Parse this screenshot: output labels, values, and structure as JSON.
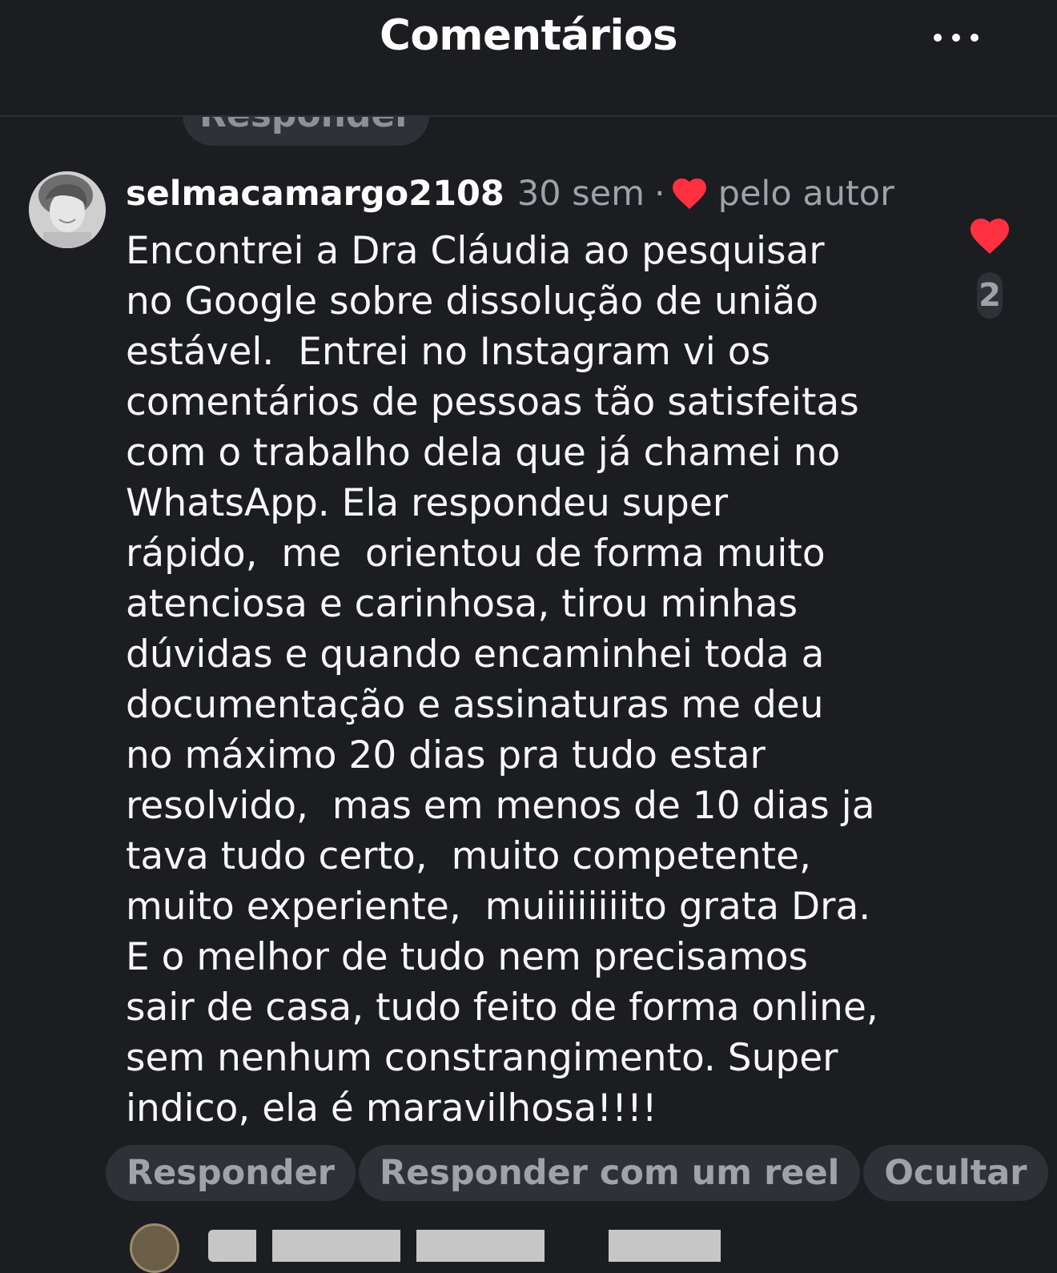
{
  "header": {
    "title": "Comentários",
    "more_icon": "more-horizontal-icon"
  },
  "previous_comment": {
    "reply_label": "Responder"
  },
  "comment": {
    "username": "selmacamargo2108",
    "time": "30 sem",
    "separator": "·",
    "author_like_icon": "heart-icon",
    "author_like_label": "pelo autor",
    "text": "Encontrei a Dra Cláudia ao pesquisar\nno Google sobre dissolução de união\nestável.  Entrei no Instagram vi os\ncomentários de pessoas tão satisfeitas\ncom o trabalho dela que já chamei no\nWhatsApp. Ela respondeu super\nrápido,  me  orientou de forma muito\natenciosa e carinhosa, tirou minhas\ndúvidas e quando encaminhei toda a\ndocumentação e assinaturas me deu\nno máximo 20 dias pra tudo estar\nresolvido,  mas em menos de 10 dias ja\ntava tudo certo,  muito competente,\nmuito experiente,  muiiiiiiiito grata Dra.\nE o melhor de tudo nem precisamos\nsair de casa, tudo feito de forma online,\nsem nenhum constrangimento. Super\nindico, ela é maravilhosa!!!!",
    "like_icon": "heart-icon",
    "like_count": "2",
    "actions": {
      "reply": "Responder",
      "reply_reel": "Responder com um reel",
      "hide": "Ocultar"
    }
  },
  "colors": {
    "background": "#1b1d21",
    "pill": "#2f3136",
    "muted_text": "#a0a2a7",
    "heart": "#ff3040"
  }
}
